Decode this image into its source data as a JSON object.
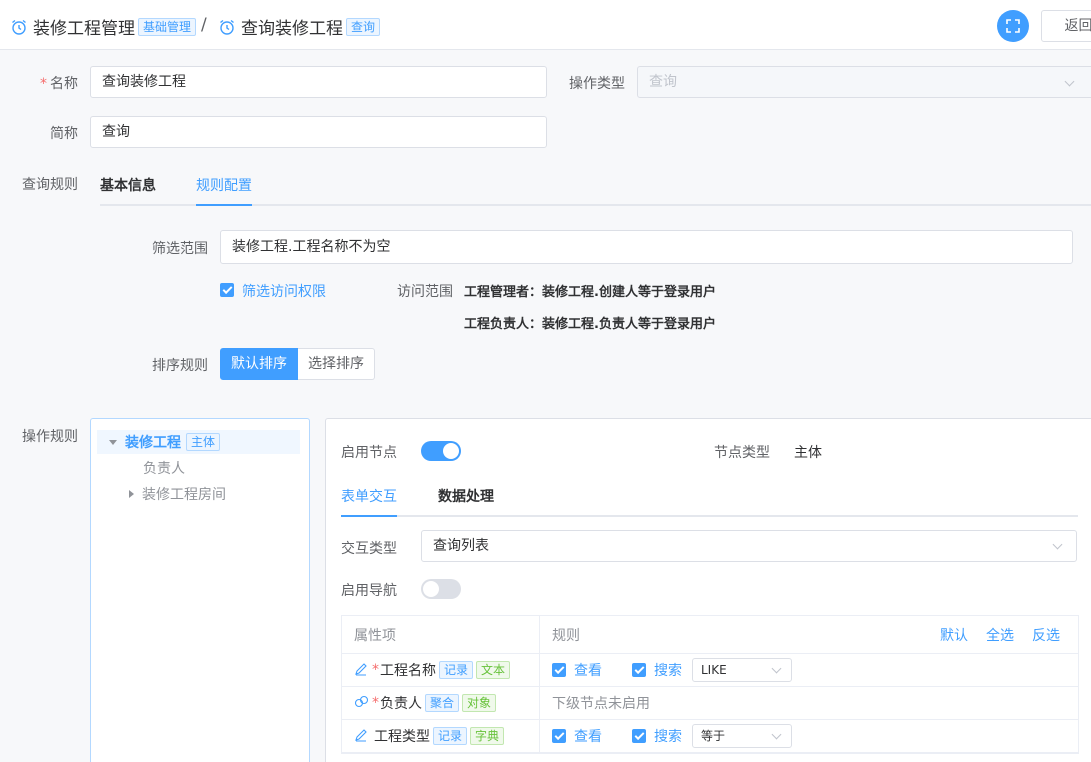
{
  "header": {
    "crumb1_title": "装修工程管理",
    "crumb1_tag": "基础管理",
    "separator": "/",
    "crumb2_title": "查询装修工程",
    "crumb2_tag": "查询",
    "back_label": "返回"
  },
  "form": {
    "name_label": "名称",
    "name_value": "查询装修工程",
    "optype_label": "操作类型",
    "optype_placeholder": "查询",
    "short_label": "简称",
    "short_value": "查询",
    "query_rule_label": "查询规则"
  },
  "rule_tabs": {
    "tab1": "基本信息",
    "tab2": "规则配置"
  },
  "rule_config": {
    "filter_label": "筛选范围",
    "filter_value": "装修工程.工程名称不为空",
    "access_checkbox": "筛选访问权限",
    "access_label": "访问范围",
    "access_rows": [
      "工程管理者：装修工程.创建人等于登录用户",
      "工程负责人：装修工程.负责人等于登录用户"
    ],
    "sort_label": "排序规则",
    "sort_default": "默认排序",
    "sort_choose": "选择排序"
  },
  "op_rule_label": "操作规则",
  "tree": {
    "root_label": "装修工程",
    "root_tag": "主体",
    "child1": "负责人",
    "child2": "装修工程房间"
  },
  "panel": {
    "enable_node_label": "启用节点",
    "node_type_label": "节点类型",
    "node_type_value": "主体",
    "tab1": "表单交互",
    "tab2": "数据处理",
    "interact_label": "交互类型",
    "interact_value": "查询列表",
    "nav_label": "启用导航",
    "grid": {
      "col1": "属性项",
      "col2": "规则",
      "act_default": "默认",
      "act_all": "全选",
      "act_invert": "反选",
      "rows": [
        {
          "name": "工程名称",
          "required": "*",
          "tag1": "记录",
          "tag2": "文本",
          "view": "查看",
          "search": "搜索",
          "op": "LIKE"
        },
        {
          "name": "负责人",
          "required": "*",
          "tag1": "聚合",
          "tag2": "对象",
          "disabled": "下级节点未启用"
        },
        {
          "name": "工程类型",
          "required": "",
          "tag1": "记录",
          "tag2": "字典",
          "view": "查看",
          "search": "搜索",
          "op": "等于"
        }
      ]
    }
  },
  "colors": {
    "primary": "#409eff",
    "danger": "#f56c6c",
    "success": "#67c23a"
  }
}
